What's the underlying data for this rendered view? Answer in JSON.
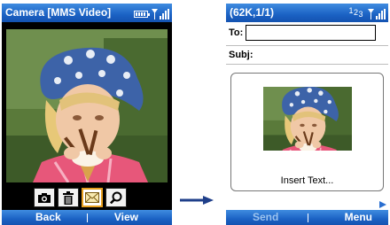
{
  "camera_screen": {
    "title": "Camera [MMS Video]",
    "softkeys": {
      "left": "Back",
      "right": "View"
    },
    "toolbar": [
      "camera-icon",
      "trash-icon",
      "envelope-icon",
      "search-icon"
    ],
    "selected_tool": "envelope-icon"
  },
  "message_screen": {
    "title": "(62K,1/1)",
    "status_numbers": "123",
    "to_label": "To:",
    "to_value": "",
    "subject_label": "Subj:",
    "insert_text": "Insert Text...",
    "softkeys": {
      "left": "Send",
      "right": "Menu"
    }
  },
  "colors": {
    "title_bar": "#1b62c4",
    "disabled_softkey": "#9cc3ee",
    "selection": "#e8a020"
  }
}
